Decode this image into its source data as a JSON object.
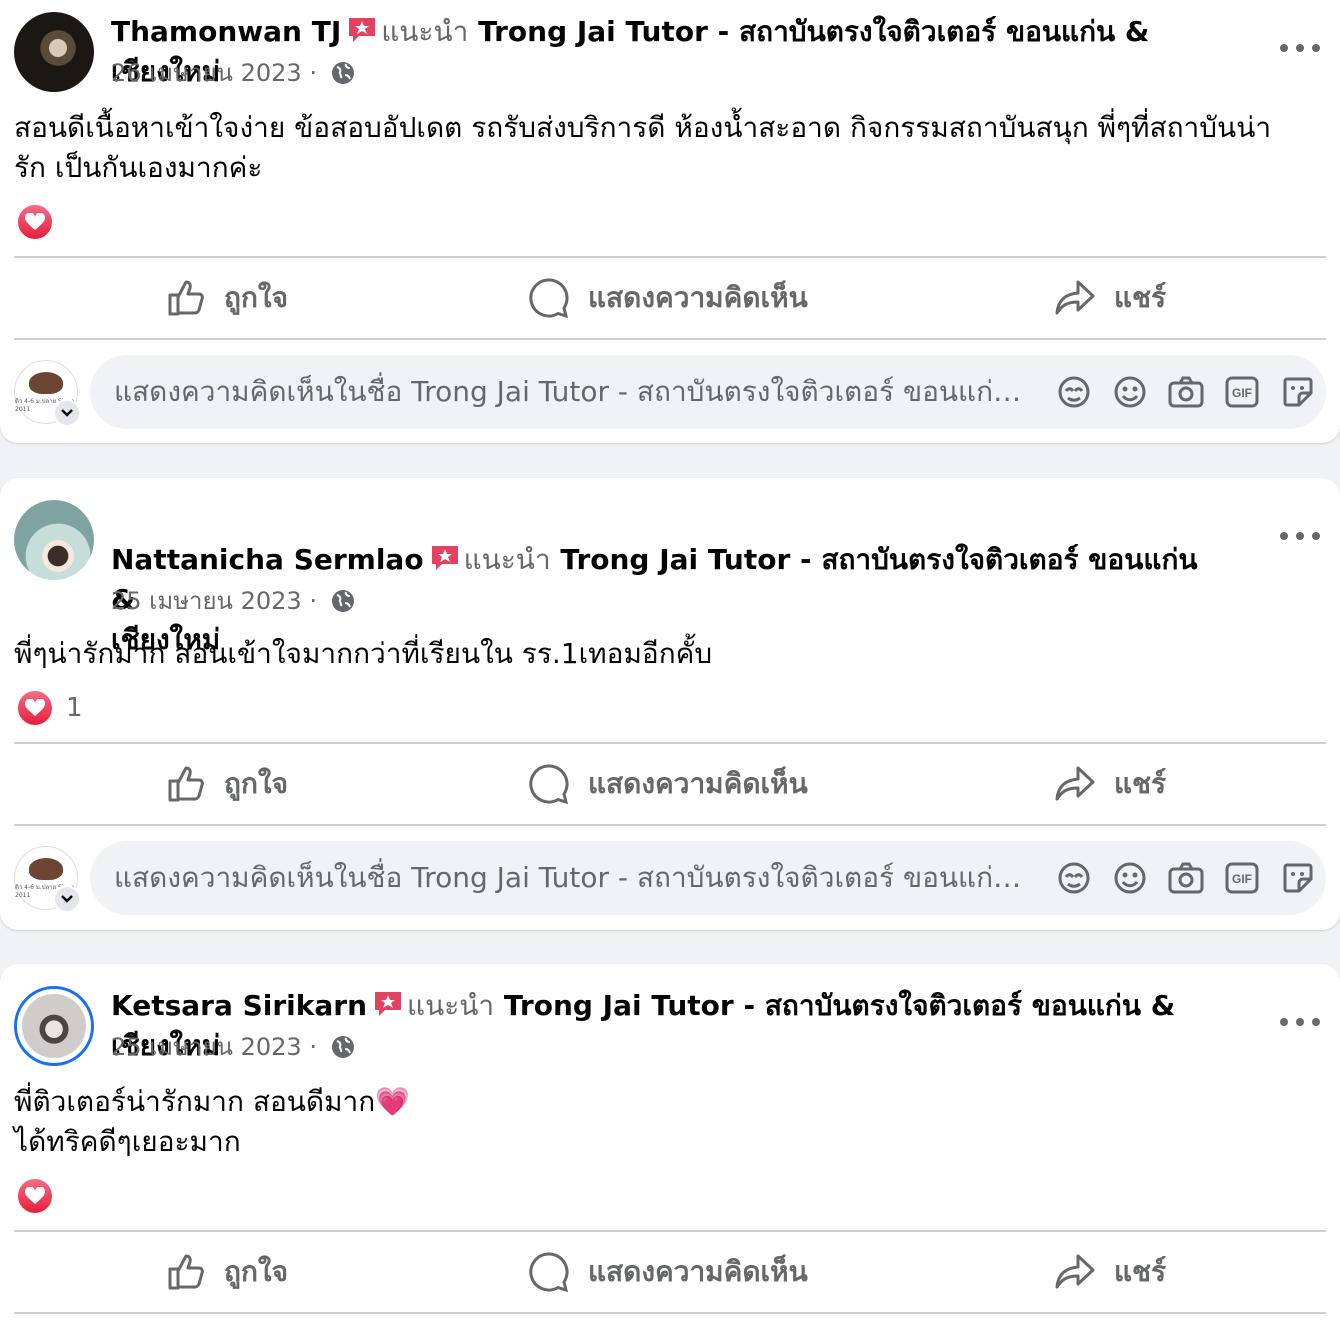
{
  "posts": [
    {
      "author": "Thamonwan TJ",
      "recommends": "แนะนำ",
      "page": "Trong Jai Tutor - สถาบันตรงใจติวเตอร์ ขอนแก่น & เชียงใหม่",
      "date": "26 เมษายน 2023",
      "separator": "·",
      "text": "สอนดีเนื้อหาเข้าใจง่าย ข้อสอบอัปเดต รถรับส่งบริการดี ห้องน้ำสะอาด กิจกรรมสถาบันสนุก พี่ๆที่สถาบันน่า\nรัก เป็นกันเองมากค่ะ",
      "reaction_count": ""
    },
    {
      "author": "Nattanicha Sermlao",
      "recommends": "แนะนำ",
      "page": "Trong Jai Tutor - สถาบันตรงใจติวเตอร์ ขอนแก่น &\nเชียงใหม่",
      "date": "25 เมษายน 2023",
      "separator": "·",
      "text": "พี่ๆน่ารักมาก สอนเข้าใจมากกว่าที่เรียนใน รร.1เทอมอีกคั้บ",
      "reaction_count": "1"
    },
    {
      "author": "Ketsara Sirikarn",
      "recommends": "แนะนำ",
      "page": "Trong Jai Tutor - สถาบันตรงใจติวเตอร์ ขอนแก่น & เชียงใหม่",
      "date": "25 เมษายน 2023",
      "separator": "·",
      "text": "พี่ติวเตอร์น่ารักมาก สอนดีมาก💗\nได้ทริคดีๆเยอะมาก",
      "reaction_count": ""
    }
  ],
  "actions": {
    "like": "ถูกใจ",
    "comment": "แสดงความคิดเห็น",
    "share": "แชร์"
  },
  "comment_placeholder": "แสดงความคิดเห็นในชื่อ Trong Jai Tutor - สถาบันตรงใจติวเตอร์ ขอนแก่น & เชียงใหม่",
  "icons": {
    "gif_label": "GIF",
    "page_logo_text": "ติว 4-6 ม.ปลาย Since 2011"
  },
  "colors": {
    "heart": "#e41e3f",
    "badge": "#e4405f",
    "secondary_text": "#65676b",
    "avatar_ring": "#1a6ff1"
  }
}
